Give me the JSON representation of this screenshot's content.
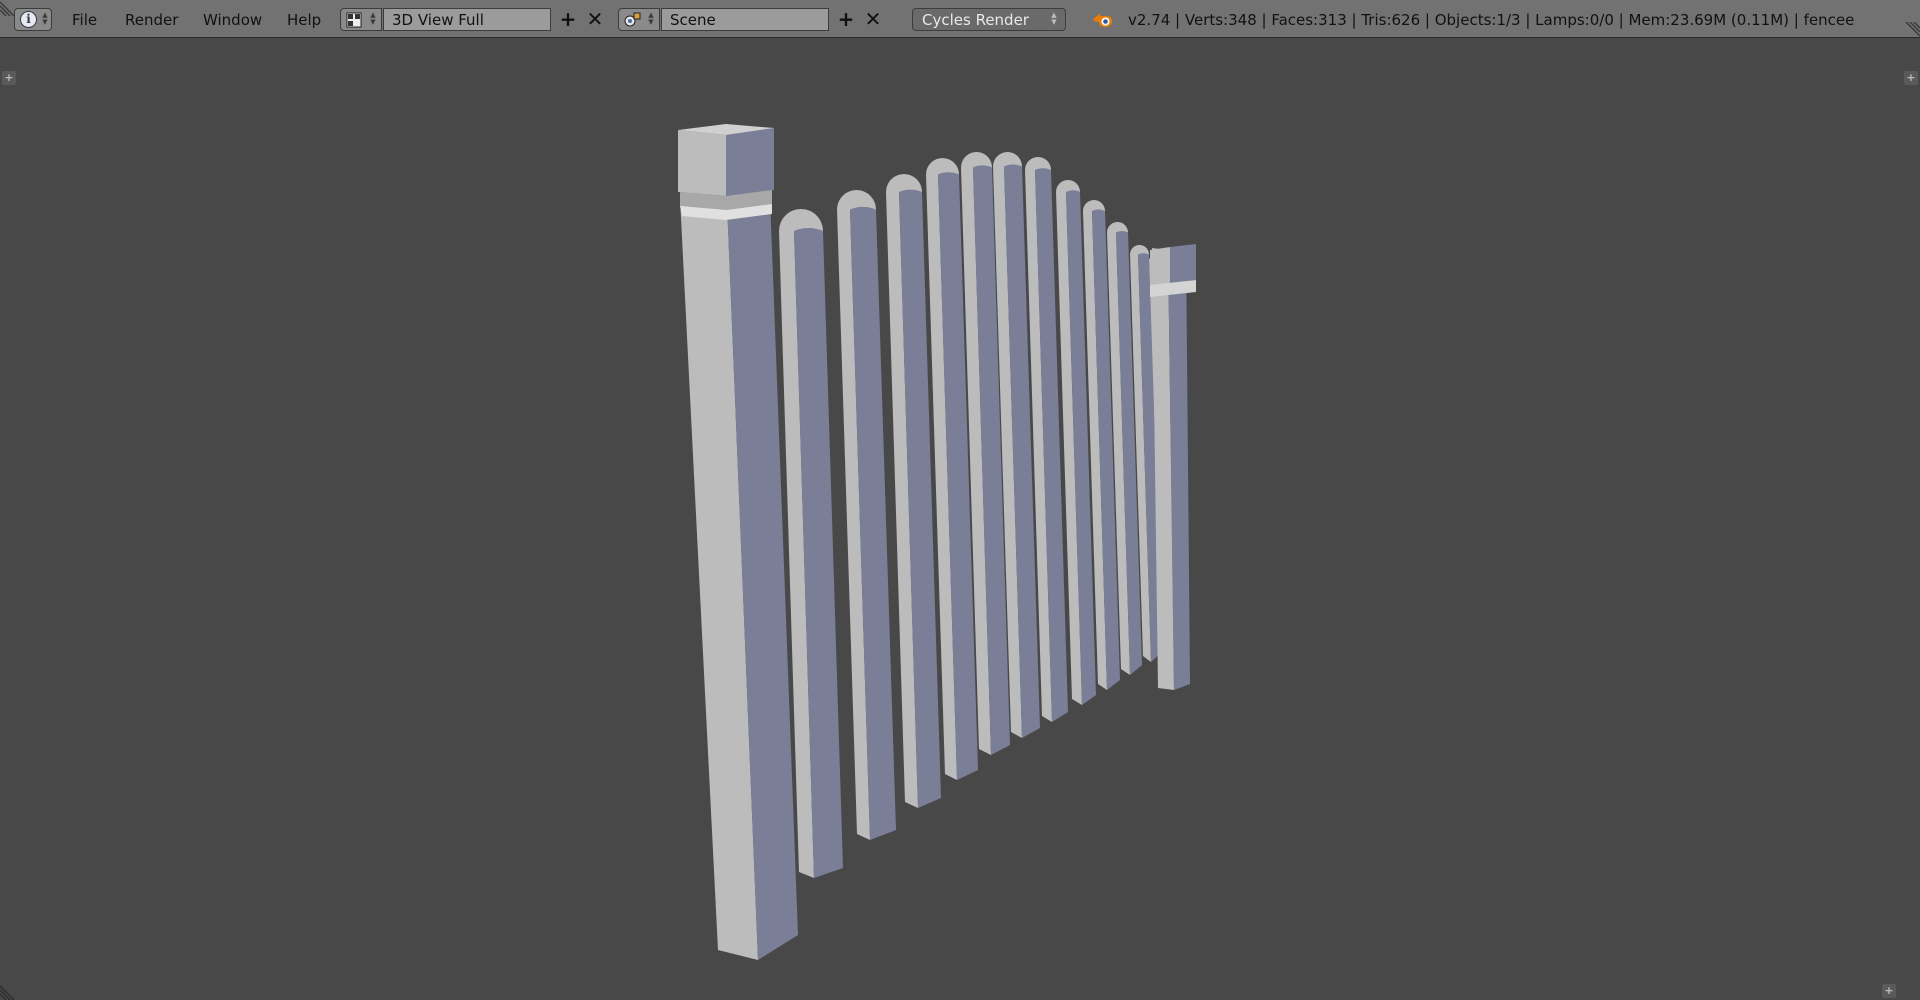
{
  "header": {
    "menus": [
      "File",
      "Render",
      "Window",
      "Help"
    ],
    "screen_layout": "3D View Full",
    "scene": "Scene",
    "render_engine": "Cycles Render",
    "stats": "v2.74 | Verts:348 | Faces:313 | Tris:626 | Objects:1/3 | Lamps:0/0 | Mem:23.69M (0.11M) | fencee"
  },
  "icons": {
    "info": "info-icon",
    "layout": "screen-layout-icon",
    "scene": "scene-icon",
    "blender": "blender-logo-icon",
    "add": "plus-icon",
    "remove": "x-icon"
  },
  "colors": {
    "header_bg": "#727272",
    "viewport_bg": "#484848",
    "field_bg": "#9b9b9b",
    "fence_lit": "#bcbcbc",
    "fence_shade": "#7a7e96"
  }
}
